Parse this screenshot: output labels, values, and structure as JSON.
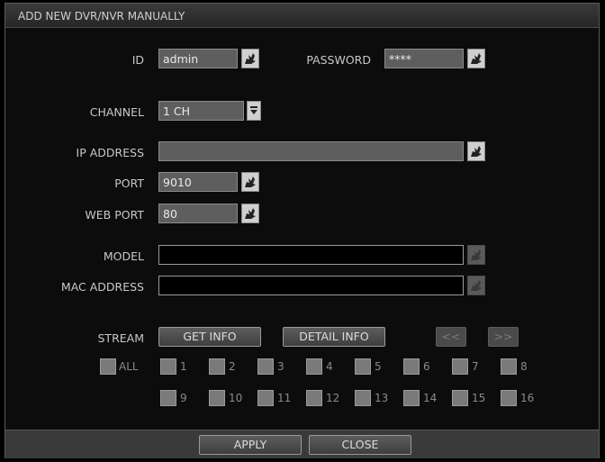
{
  "dialog": {
    "title": "ADD NEW DVR/NVR MANUALLY"
  },
  "form": {
    "id_label": "ID",
    "id_value": "admin",
    "password_label": "PASSWORD",
    "password_value": "****",
    "channel_label": "CHANNEL",
    "channel_value": "1 CH",
    "ip_label": "IP ADDRESS",
    "ip_value": "",
    "port_label": "PORT",
    "port_value": "9010",
    "webport_label": "WEB PORT",
    "webport_value": "80",
    "model_label": "MODEL",
    "model_value": "",
    "mac_label": "MAC ADDRESS",
    "mac_value": ""
  },
  "stream": {
    "label": "STREAM",
    "get_info": "GET INFO",
    "detail_info": "DETAIL INFO",
    "prev": "<<",
    "next": ">>",
    "all_label": "ALL",
    "channels": [
      "1",
      "2",
      "3",
      "4",
      "5",
      "6",
      "7",
      "8",
      "9",
      "10",
      "11",
      "12",
      "13",
      "14",
      "15",
      "16"
    ]
  },
  "footer": {
    "apply": "APPLY",
    "close": "CLOSE"
  },
  "icons": {
    "keyboard": "virtual-keyboard-icon",
    "dropdown": "dropdown-arrow-icon"
  }
}
